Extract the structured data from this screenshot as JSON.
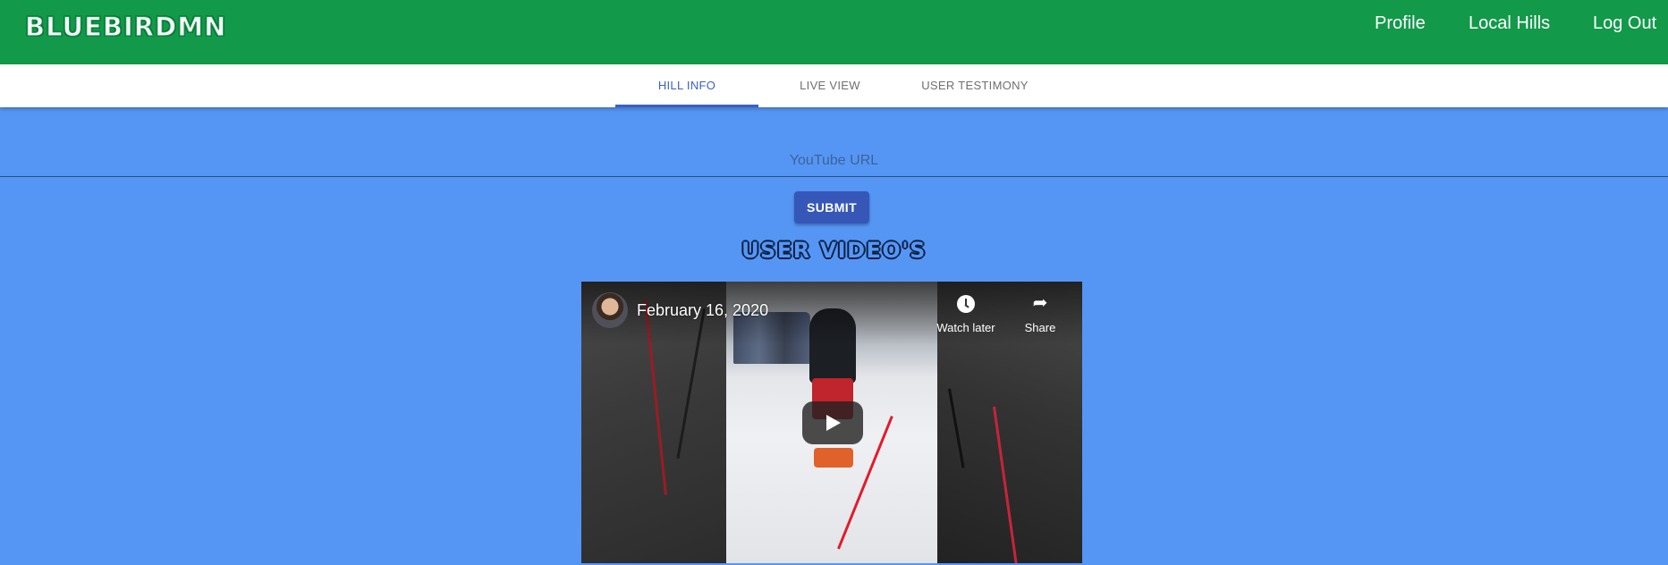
{
  "app": {
    "brand": "BLUEBIRDMN",
    "nav": {
      "profile": "Profile",
      "local_hills": "Local Hills",
      "log_out": "Log Out"
    }
  },
  "tabs": [
    {
      "label": "HILL INFO",
      "active": true
    },
    {
      "label": "LIVE VIEW",
      "active": false
    },
    {
      "label": "USER TESTIMONY",
      "active": false
    }
  ],
  "form": {
    "url_placeholder": "YouTube URL",
    "url_value": "",
    "submit_label": "SUBMIT"
  },
  "section": {
    "title": "USER VIDEO'S"
  },
  "video": {
    "title": "February 16, 2020",
    "watch_later_label": "Watch later",
    "share_label": "Share",
    "icons": {
      "channel_avatar": "avatar",
      "watch_later": "clock-icon",
      "share": "share-arrow-icon",
      "play": "play-icon"
    }
  },
  "colors": {
    "appbar": "#12994a",
    "background": "#5596f5",
    "accent": "#3b5fc4",
    "button": "#3657b8"
  }
}
